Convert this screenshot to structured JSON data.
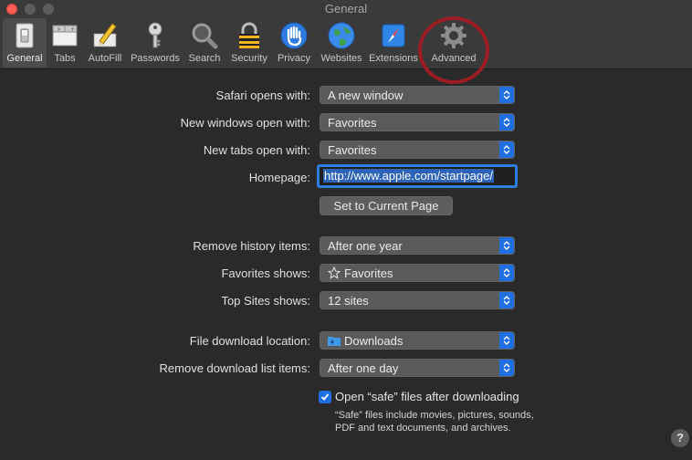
{
  "window": {
    "title": "General"
  },
  "toolbar": {
    "items": [
      {
        "label": "General",
        "icon": "general-switch-icon"
      },
      {
        "label": "Tabs",
        "icon": "tabs-icon"
      },
      {
        "label": "AutoFill",
        "icon": "autofill-pencil-icon"
      },
      {
        "label": "Passwords",
        "icon": "key-icon"
      },
      {
        "label": "Search",
        "icon": "magnifier-icon"
      },
      {
        "label": "Security",
        "icon": "padlock-icon"
      },
      {
        "label": "Privacy",
        "icon": "hand-icon"
      },
      {
        "label": "Websites",
        "icon": "globe-icon"
      },
      {
        "label": "Extensions",
        "icon": "compass-puzzle-icon"
      },
      {
        "label": "Advanced",
        "icon": "gear-icon"
      }
    ],
    "selected": "General"
  },
  "settings": {
    "safari_opens_with": {
      "label": "Safari opens with:",
      "value": "A new window"
    },
    "new_windows_open_with": {
      "label": "New windows open with:",
      "value": "Favorites"
    },
    "new_tabs_open_with": {
      "label": "New tabs open with:",
      "value": "Favorites"
    },
    "homepage": {
      "label": "Homepage:",
      "value": "http://www.apple.com/startpage/"
    },
    "set_current_page": {
      "label": "Set to Current Page"
    },
    "remove_history": {
      "label": "Remove history items:",
      "value": "After one year"
    },
    "favorites_shows": {
      "label": "Favorites shows:",
      "value": "Favorites"
    },
    "top_sites_shows": {
      "label": "Top Sites shows:",
      "value": "12 sites"
    },
    "download_location": {
      "label": "File download location:",
      "value": "Downloads"
    },
    "remove_download_list": {
      "label": "Remove download list items:",
      "value": "After one day"
    },
    "open_safe_files": {
      "label": "Open “safe” files after downloading",
      "checked": true,
      "note": "“Safe” files include movies, pictures, sounds, PDF and text documents, and archives."
    }
  },
  "help": {
    "label": "?"
  },
  "colors": {
    "accent": "#1f6fe3",
    "highlight_ring": "#9b1c22",
    "background": "#2a2a2a"
  }
}
